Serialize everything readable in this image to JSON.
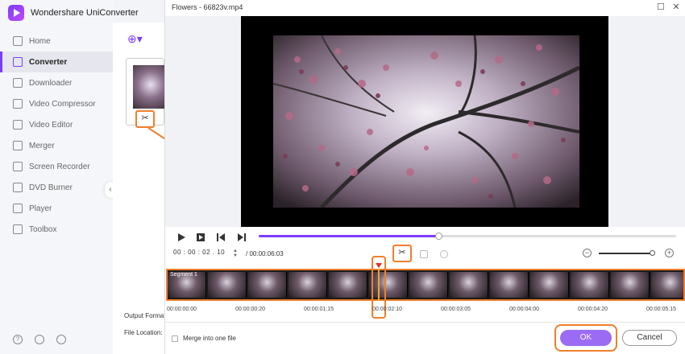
{
  "app": {
    "name": "Wondershare UniConverter"
  },
  "sidebar": {
    "items": [
      {
        "label": "Home",
        "icon": "home-icon"
      },
      {
        "label": "Converter",
        "icon": "converter-icon",
        "active": true
      },
      {
        "label": "Downloader",
        "icon": "download-icon"
      },
      {
        "label": "Video Compressor",
        "icon": "compress-icon"
      },
      {
        "label": "Video Editor",
        "icon": "scissors-icon"
      },
      {
        "label": "Merger",
        "icon": "merge-icon"
      },
      {
        "label": "Screen Recorder",
        "icon": "record-icon"
      },
      {
        "label": "DVD Burner",
        "icon": "disc-icon"
      },
      {
        "label": "Player",
        "icon": "play-icon"
      },
      {
        "label": "Toolbox",
        "icon": "grid-icon"
      }
    ],
    "bottom_icons": [
      "help-icon",
      "bell-icon",
      "feedback-icon"
    ]
  },
  "workspace": {
    "output_format_label": "Output Format",
    "file_location_label": "File Location:"
  },
  "dialog": {
    "title": "Flowers - 66823v.mp4",
    "current_time": "00 : 00 : 02 . 10",
    "total_time": "/ 00:00:06:03",
    "playback_progress": 0.43,
    "zoom_level": 0.96,
    "segment_label": "Segment 1",
    "ruler_ticks": [
      "00:00:00:00",
      "00:00:00:20",
      "00:00:01:15",
      "00:00:02:10",
      "00:00:03:05",
      "00:00:04:00",
      "00:00:04:20",
      "00:00:05:15"
    ],
    "merge_label": "Merge into one file",
    "ok_label": "OK",
    "cancel_label": "Cancel"
  },
  "colors": {
    "accent": "#7b3cff",
    "highlight": "#f07f2c",
    "ok_button": "#9b6bf5"
  }
}
